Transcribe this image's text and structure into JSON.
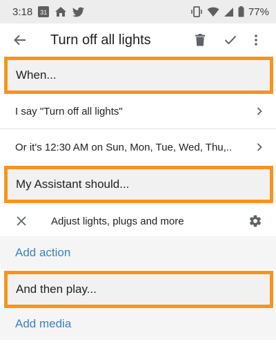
{
  "status_bar": {
    "time": "3:18",
    "calendar_day": "31",
    "battery": "77%"
  },
  "app_bar": {
    "title": "Turn off all lights"
  },
  "sections": {
    "when_header": "When...",
    "assistant_header": "My Assistant should...",
    "play_header": "And then play..."
  },
  "when": {
    "trigger_phrase": "I say \"Turn off all lights\"",
    "schedule": "Or it's 12:30 AM on Sun, Mon, Tue, Wed, Thu,.."
  },
  "assistant": {
    "action_label": "Adjust lights, plugs and more",
    "add_action": "Add action"
  },
  "media": {
    "add_media": "Add media"
  },
  "colors": {
    "highlight": "#f7941d",
    "link": "#3b82c4"
  }
}
